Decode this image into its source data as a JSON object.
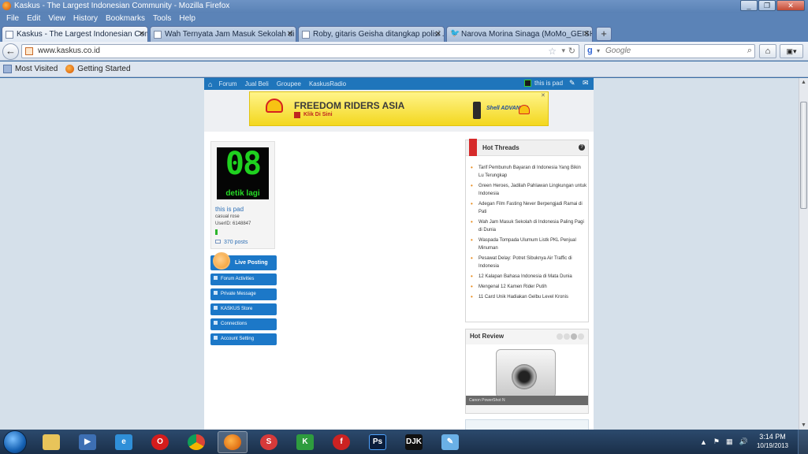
{
  "window": {
    "title": "Kaskus - The Largest Indonesian Community - Mozilla Firefox",
    "controls": [
      "minimize",
      "restore",
      "close"
    ]
  },
  "menu": [
    "File",
    "Edit",
    "View",
    "History",
    "Bookmarks",
    "Tools",
    "Help"
  ],
  "tabs": [
    {
      "label": "Kaskus - The Largest Indonesian Com...",
      "icon": "kaskus-favicon"
    },
    {
      "label": "Wah Ternyata Jam Masuk Sekolah di I...",
      "icon": "kaskus-favicon"
    },
    {
      "label": "Roby, gitaris Geisha ditangkap polisi ...",
      "icon": "kaskus-favicon"
    },
    {
      "label": "Narova Morina Sinaga (MoMo_GEISH...",
      "icon": "twitter-bird"
    }
  ],
  "nav": {
    "url": "www.kaskus.co.id",
    "search_placeholder": "Google"
  },
  "bookmarks": [
    {
      "label": "Most Visited",
      "icon": "bookmark-folder-icon"
    },
    {
      "label": "Getting Started",
      "icon": "firefox-icon"
    }
  ],
  "site_nav": {
    "links": [
      "Forum",
      "Jual Beli",
      "Groupee",
      "KaskusRadio"
    ],
    "username": "this is pad"
  },
  "banner": {
    "title": "FREEDOM RIDERS ASIA",
    "subtitle": "Klik Di Sini",
    "product": "Shell ADVANCE"
  },
  "profile": {
    "avatar_digits": "08",
    "avatar_caption": "detik lagi",
    "username": "this is pad",
    "role": "casual rose",
    "user_id": "UserID: 6148847",
    "posts": "370 posts"
  },
  "sidebar_buttons": [
    "Live Posting",
    "Forum Activities",
    "Private Message",
    "KASKUS Store",
    "Connections",
    "Account Setting"
  ],
  "hot_threads": {
    "title": "Hot Threads",
    "items": [
      "Tarif Pembunuh Bayaran di Indonesia Yang Bikin Lu Terungkap",
      "Green Heroes, Jadilah Pahlawan Lingkungan untuk Indonesia",
      "Adegan Film Fasting Never Berpengjadi Ramai di Pati",
      "Wah Jam Masuk Sekolah di Indonesia Paling Pagi di Dunia",
      "Waspada Tompada Ulumum Listk PKL Penjual Minuman",
      "Pesawat Delay: Potret Sibuknya Air Traffic di Indonesia",
      "12 Kalapan Bahasa Indonesia di Mata Dunia",
      "Mengenal 12 Kamen Rider Putih",
      "11 Card Unik Hadiakan Gelbu Level Kronis"
    ]
  },
  "hot_review": {
    "title": "Hot Review",
    "caption": "Canon PowerShot N"
  },
  "taskbar": {
    "apps": [
      "windows-explorer",
      "media-player",
      "internet-explorer",
      "opera",
      "chrome",
      "firefox",
      "speedy",
      "kaskus-app",
      "flash",
      "photoshop",
      "djk",
      "paint"
    ],
    "photoshop_label": "Ps",
    "djk_label": "DJK",
    "time": "3:14 PM",
    "date": "10/19/2013"
  }
}
